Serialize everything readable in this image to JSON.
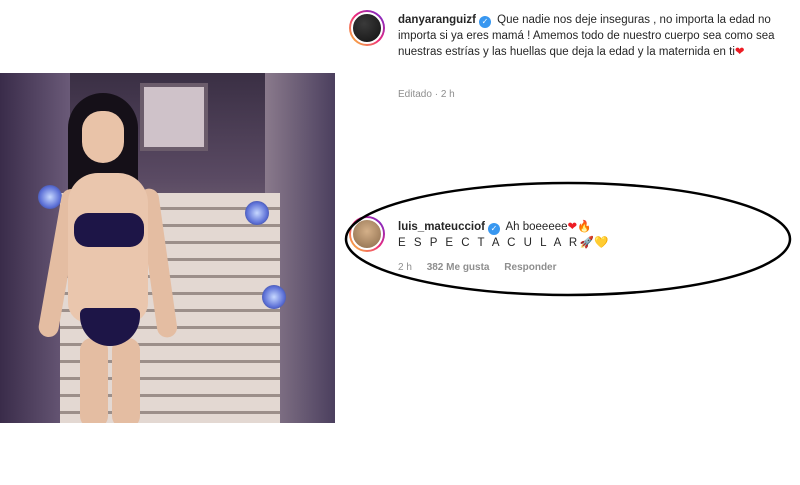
{
  "post": {
    "username": "danyaranguizf",
    "verified": true,
    "caption": "Que nadie nos deje inseguras , no importa la edad no importa si ya eres mamá ! Amemos todo de nuestro cuerpo sea como sea nuestras estrías y las huellas que deja la edad y la maternida en ti",
    "caption_emoji": "❤",
    "edited_label": "Editado",
    "separator": "·",
    "time": "2 h"
  },
  "comment": {
    "username": "luis_mateucciof",
    "verified": true,
    "text": "Ah boeeeee",
    "emoji_1": "❤",
    "emoji_2": "🔥",
    "text_line2": "E S P E C T A C U L A R",
    "emoji_3": "🚀",
    "emoji_4": "💛",
    "time": "2 h",
    "likes": "382 Me gusta",
    "reply_label": "Responder"
  },
  "icons": {
    "verified": "verified-badge-icon",
    "highlight": "annotation-ellipse"
  },
  "colors": {
    "text": "#262626",
    "meta": "#8e8e8e",
    "verified": "#3897f0",
    "ellipse": "#000000"
  }
}
